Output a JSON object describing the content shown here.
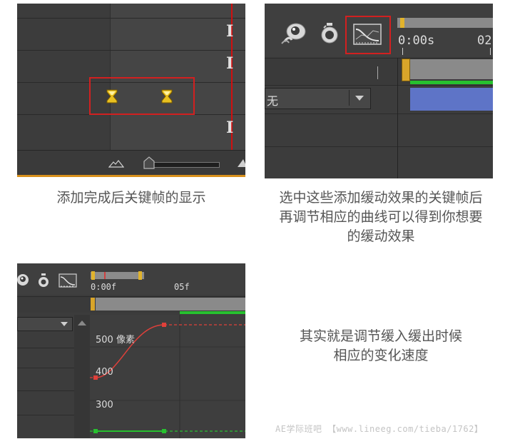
{
  "panel1": {
    "caption": "添加完成后关键帧的显示"
  },
  "panel2": {
    "time_start": "0:00s",
    "time_next": "02",
    "dropdown_value": "无",
    "caption": "选中这些添加缓动效果的关键帧后\n再调节相应的曲线可以得到你想要\n的缓动效果"
  },
  "panel3": {
    "time_start": "0:00f",
    "time_next": "05f",
    "label_500": "500 像素",
    "label_400": "400",
    "label_300": "300",
    "caption": "其实就是调节缓入缓出时候\n相应的变化速度"
  },
  "watermark": "AE学际班吧 【www.lineeg.com/tieba/1762】",
  "colors": {
    "panel_bg": "#3c3c3c",
    "highlight_red": "#d22020",
    "keyframe_yellow": "#e8c020",
    "layer_bar_blue": "#5e74c7",
    "work_area_green": "#27c12f",
    "graph_curve_red": "#e0403a"
  },
  "icons": [
    "motion-blur-icon",
    "stopwatch-icon",
    "graph-editor-icon",
    "mountain-zoom-icon",
    "keyframe-hourglass-icon"
  ]
}
